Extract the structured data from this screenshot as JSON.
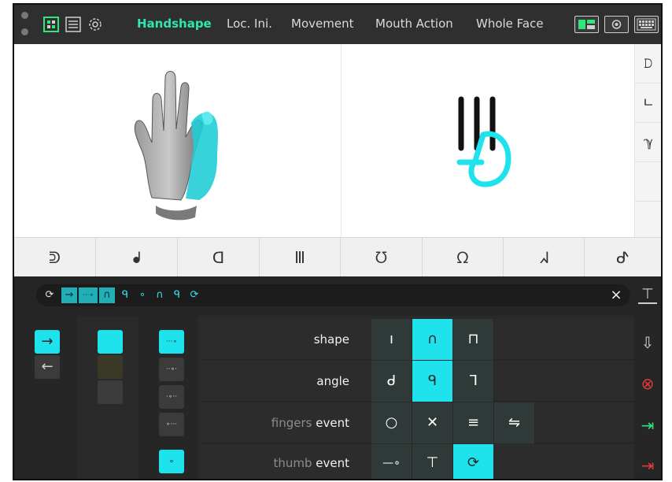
{
  "tabs": [
    {
      "label": "Handshape",
      "active": true
    },
    {
      "label": "Loc. Ini.",
      "active": false
    },
    {
      "label": "Movement",
      "active": false
    },
    {
      "label": "Mouth Action",
      "active": false
    },
    {
      "label": "Whole Face",
      "active": false
    }
  ],
  "toolbar_icons": [
    "grid-view-icon",
    "list-view-icon",
    "settings-icon"
  ],
  "right_buttons": [
    "layout-toggle-icon",
    "camera-icon",
    "keyboard-icon"
  ],
  "side_icons": [
    "𝙳",
    "ㄴ",
    "ℽ"
  ],
  "handshapes": [
    "ᕲ",
    "ᖱ",
    "ᗡ",
    "Ⅲ",
    "ᘮ",
    "ᘯ",
    "ᖽ",
    "ᕷ"
  ],
  "sequence": {
    "refresh_icon": "⟳",
    "items": [
      {
        "symbol": "→",
        "highlight": true
      },
      {
        "symbol": "···∘",
        "highlight": true
      },
      {
        "symbol": "∩",
        "highlight": true
      },
      {
        "symbol": "ᑫ",
        "highlight": false
      },
      {
        "symbol": "∘",
        "highlight": false
      },
      {
        "symbol": "∩",
        "highlight": false
      },
      {
        "symbol": "ᑫ",
        "highlight": false
      },
      {
        "symbol": "⟳",
        "highlight": false
      }
    ],
    "close_icon": "×",
    "collapse_icon": "⊤"
  },
  "direction": {
    "forward": "→",
    "back": "←"
  },
  "positions": [
    "···∘",
    "··∘·",
    "·∘··",
    "∘···",
    "∘"
  ],
  "rows": [
    {
      "label_dim": "",
      "label": "shape",
      "cells": [
        {
          "t": "ı",
          "on": false
        },
        {
          "t": "∩",
          "on": true
        },
        {
          "t": "⊓",
          "on": false
        }
      ]
    },
    {
      "label_dim": "",
      "label": "angle",
      "cells": [
        {
          "t": "ᑯ",
          "on": false
        },
        {
          "t": "ᑫ",
          "on": true
        },
        {
          "t": "ᒣ",
          "on": false
        }
      ]
    },
    {
      "label_dim": "fingers",
      "label": "event",
      "cells": [
        {
          "t": "○",
          "on": false
        },
        {
          "t": "✕",
          "on": false
        },
        {
          "t": "≡",
          "on": false
        },
        {
          "t": "⇋",
          "on": false
        }
      ]
    },
    {
      "label_dim": "thumb",
      "label": "event",
      "cells": [
        {
          "t": "—∘",
          "on": false
        },
        {
          "t": "⊤",
          "on": false
        },
        {
          "t": "⟳",
          "on": true
        }
      ]
    }
  ],
  "right_actions": [
    {
      "name": "export-icon",
      "glyph": "⇩",
      "color": "#cfcfcf"
    },
    {
      "name": "cancel-icon",
      "glyph": "⊗",
      "color": "#e23b3b"
    },
    {
      "name": "exit-icon",
      "glyph": "⇥",
      "color": "#2ee67a"
    },
    {
      "name": "exit-all-icon",
      "glyph": "⇥",
      "color": "#e23b3b"
    }
  ],
  "colors": {
    "accent": "#1fe3ec",
    "tab_active": "#2ee6b0"
  }
}
